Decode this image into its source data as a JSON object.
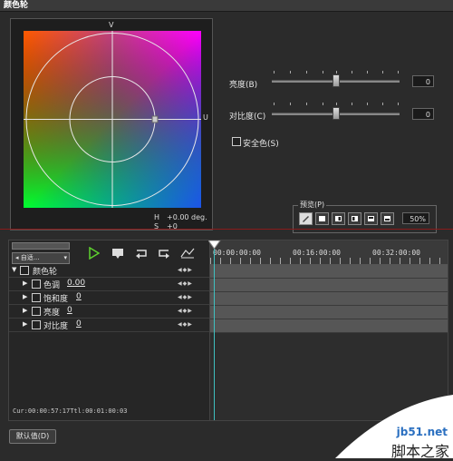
{
  "window": {
    "title": "颜色轮"
  },
  "wheel": {
    "axis_v": "V",
    "axis_u": "U",
    "h_label": "H",
    "h_value": "+0.00 deg.",
    "s_label": "S",
    "s_value": "+0"
  },
  "sliders": [
    {
      "label": "亮度(B)",
      "value": "0",
      "position": 0.5
    },
    {
      "label": "对比度(C)",
      "value": "0",
      "position": 0.5
    }
  ],
  "safe_color": {
    "label": "安全色(S)",
    "checked": false
  },
  "preview": {
    "label": "预览(P)",
    "zoom": "50%"
  },
  "timeline_controls": {
    "mode": "自适..."
  },
  "tree": [
    {
      "label": "颜色轮",
      "value": ""
    },
    {
      "label": "色调",
      "value": "0.00"
    },
    {
      "label": "饱和度",
      "value": "0"
    },
    {
      "label": "亮度",
      "value": "0"
    },
    {
      "label": "对比度",
      "value": "0"
    }
  ],
  "timeline": {
    "ticks": [
      "00:00:00:00",
      "00:16:00:00",
      "00:32:00:00"
    ],
    "status": "Cur:00:00:57:17Ttl:00:01:00:03"
  },
  "footer": {
    "default_button": "默认值(D)"
  },
  "watermark": {
    "line1": "jb51.net",
    "line2": "脚本之家"
  },
  "colors": {
    "accent_green": "#5ed12e",
    "divider_red": "#8a1a1a",
    "playhead": "#3fc0c0"
  }
}
